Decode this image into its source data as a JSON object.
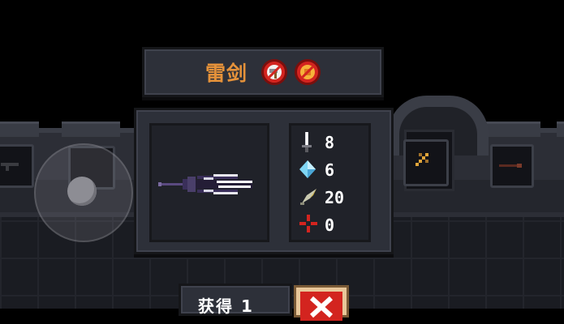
{
  "weapon": {
    "name": "雷剑",
    "badges": [
      {
        "icon": "no-hammer-icon"
      },
      {
        "icon": "no-forge-icon"
      }
    ]
  },
  "stats": [
    {
      "icon": "sword-attack-icon",
      "value": "8"
    },
    {
      "icon": "energy-crystal-icon",
      "value": "6"
    },
    {
      "icon": "crit-feather-icon",
      "value": "20"
    },
    {
      "icon": "accuracy-crosshair-icon",
      "value": "0"
    }
  ],
  "bottom": {
    "label": "获得 1",
    "close_icon": "close-x-icon"
  },
  "colors": {
    "name": "#e5923a",
    "panel": "#2d3039",
    "badge_red": "#d3241f"
  }
}
